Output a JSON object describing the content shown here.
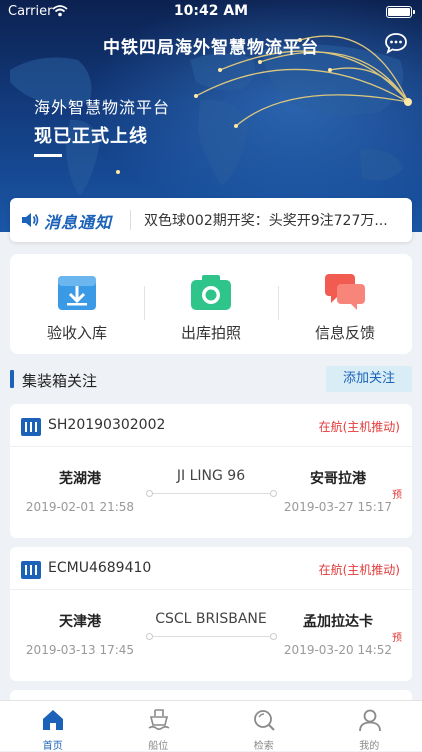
{
  "status_bar": {
    "carrier": "Carrier",
    "time": "10:42 AM"
  },
  "header": {
    "title": "中铁四局海外智慧物流平台"
  },
  "banner": {
    "line1": "海外智慧物流平台",
    "line2": "现已正式上线"
  },
  "notice": {
    "label": "消息通知",
    "text": "双色球002期开奖：头奖开9注727万..."
  },
  "actions": [
    {
      "label": "验收入库",
      "icon": "inbox-download-icon"
    },
    {
      "label": "出库拍照",
      "icon": "camera-icon"
    },
    {
      "label": "信息反馈",
      "icon": "chat-feedback-icon"
    }
  ],
  "section": {
    "title": "集装箱关注",
    "add_label": "添加关注"
  },
  "containers": [
    {
      "id": "SH20190302002",
      "status": "在航(主机推动)",
      "from": "芜湖港",
      "to": "安哥拉港",
      "ship": "JI LING 96",
      "from_date": "2019-02-01 21:58",
      "to_date": "2019-03-27 15:17",
      "flag": "预"
    },
    {
      "id": "ECMU4689410",
      "status": "在航(主机推动)",
      "from": "天津港",
      "to": "孟加拉达卡",
      "ship": "CSCL BRISBANE",
      "from_date": "2019-03-13 17:45",
      "to_date": "2019-03-20 14:52",
      "flag": "预"
    }
  ],
  "tabs": [
    {
      "label": "首页",
      "icon": "home-icon",
      "active": true
    },
    {
      "label": "船位",
      "icon": "ship-icon",
      "active": false
    },
    {
      "label": "检索",
      "icon": "search-icon",
      "active": false
    },
    {
      "label": "我的",
      "icon": "user-icon",
      "active": false
    }
  ],
  "colors": {
    "accent": "#1b62b8",
    "status_red": "#e23b3b",
    "inbox": "#3a9ae6",
    "camera": "#2fc48a",
    "feedback": "#f25b4f"
  }
}
